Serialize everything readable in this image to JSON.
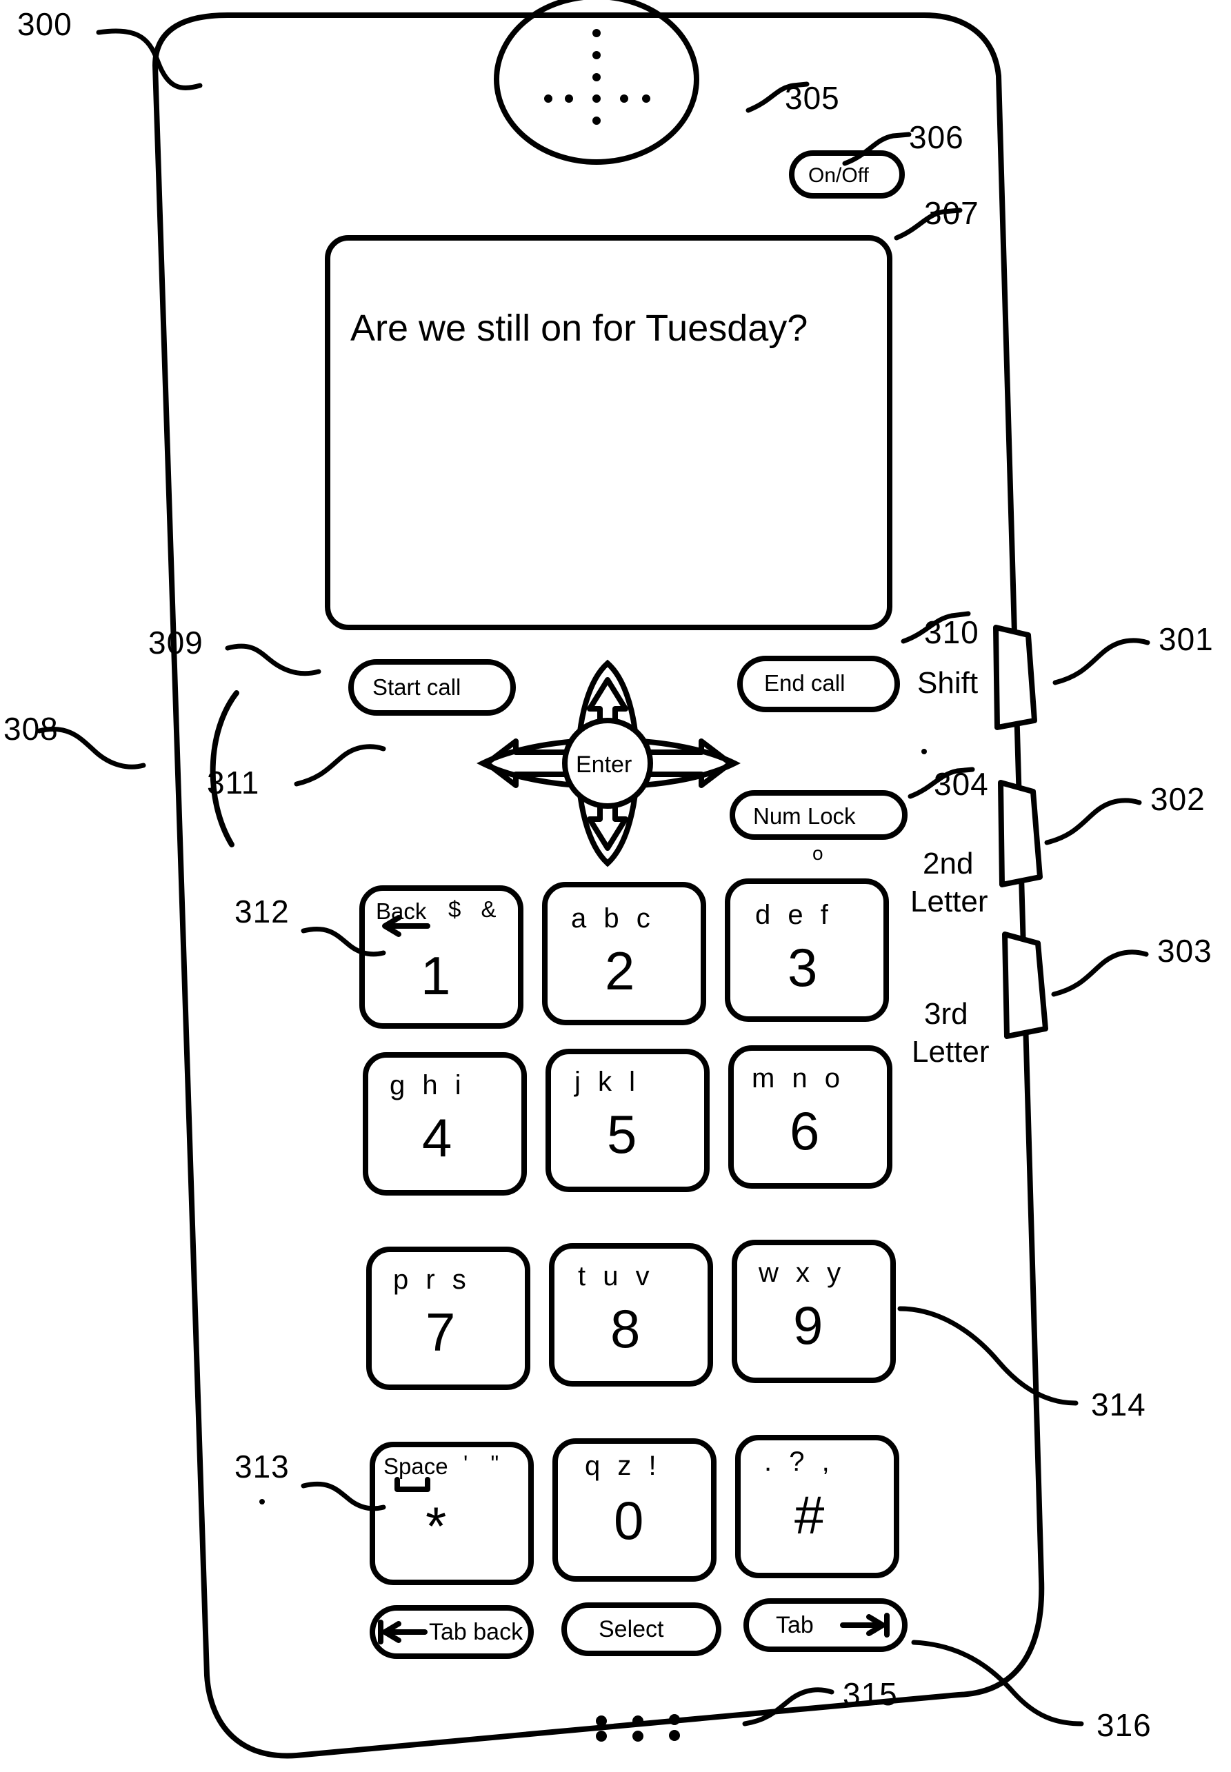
{
  "figure": {
    "kind": "patent-figure",
    "device_name": "handheld telephone with alphanumeric keypad",
    "ink_color": "#000000",
    "background_color": "#ffffff"
  },
  "reference_numerals": [
    {
      "id": "300",
      "label": "300",
      "target": "phone-body"
    },
    {
      "id": "301",
      "label": "301",
      "target": "shift-side-button"
    },
    {
      "id": "302",
      "label": "302",
      "target": "second-letter-side-button"
    },
    {
      "id": "303",
      "label": "303",
      "target": "third-letter-side-button"
    },
    {
      "id": "304",
      "label": "304",
      "target": "num-lock-button"
    },
    {
      "id": "305",
      "label": "305",
      "target": "earpiece-speaker"
    },
    {
      "id": "306",
      "label": "306",
      "target": "on-off-button"
    },
    {
      "id": "307",
      "label": "307",
      "target": "display-screen"
    },
    {
      "id": "308",
      "label": "308",
      "target": "left-edge-bulge"
    },
    {
      "id": "309",
      "label": "309",
      "target": "start-call-button"
    },
    {
      "id": "310",
      "label": "310",
      "target": "end-call-button"
    },
    {
      "id": "311",
      "label": "311",
      "target": "navigation-cluster"
    },
    {
      "id": "312",
      "label": "312",
      "target": "key-1"
    },
    {
      "id": "313",
      "label": "313",
      "target": "key-star"
    },
    {
      "id": "314",
      "label": "314",
      "target": "key-9"
    },
    {
      "id": "315",
      "label": "315",
      "target": "microphone"
    },
    {
      "id": "316",
      "label": "316",
      "target": "tab-button"
    }
  ],
  "display": {
    "message": "Are we still on for Tuesday?"
  },
  "top_controls": {
    "on_off_label": "On/Off"
  },
  "call_controls": {
    "start_call_label": "Start call",
    "end_call_label": "End call",
    "num_lock_label": "Num Lock",
    "num_lock_indicator": "o"
  },
  "navigation": {
    "enter_label": "Enter",
    "up_icon": "arrow-up-icon",
    "down_icon": "arrow-down-icon",
    "left_icon": "arrow-left-icon",
    "right_icon": "arrow-right-icon"
  },
  "side_buttons": [
    {
      "name": "shift",
      "label_line1": "Shift",
      "label_line2": ""
    },
    {
      "name": "second-letter",
      "label_line1": "2nd",
      "label_line2": "Letter"
    },
    {
      "name": "third-letter",
      "label_line1": "3rd",
      "label_line2": "Letter"
    }
  ],
  "keypad": {
    "rows": [
      [
        {
          "name": "key-1",
          "digit": "1",
          "function_label": "Back",
          "function_icon": "arrow-left-icon",
          "symbols": "$ &",
          "letters": ""
        },
        {
          "name": "key-2",
          "digit": "2",
          "letters": "a b c",
          "symbols": ""
        },
        {
          "name": "key-3",
          "digit": "3",
          "letters": "d e f",
          "symbols": ""
        }
      ],
      [
        {
          "name": "key-4",
          "digit": "4",
          "letters": "g h i",
          "symbols": ""
        },
        {
          "name": "key-5",
          "digit": "5",
          "letters": "j k l",
          "symbols": ""
        },
        {
          "name": "key-6",
          "digit": "6",
          "letters": "m n o",
          "symbols": ""
        }
      ],
      [
        {
          "name": "key-7",
          "digit": "7",
          "letters": "p r s",
          "symbols": ""
        },
        {
          "name": "key-8",
          "digit": "8",
          "letters": "t u v",
          "symbols": ""
        },
        {
          "name": "key-9",
          "digit": "9",
          "letters": "w x y",
          "symbols": ""
        }
      ],
      [
        {
          "name": "key-star",
          "digit": "*",
          "function_label": "Space",
          "function_icon": "underscore-bracket-icon",
          "symbols": "'  \"",
          "letters": ""
        },
        {
          "name": "key-0",
          "digit": "0",
          "letters": "q z !",
          "symbols": ""
        },
        {
          "name": "key-hash",
          "digit": "#",
          "letters": ". ? ,",
          "symbols": ""
        }
      ]
    ]
  },
  "bottom_buttons": [
    {
      "name": "tab-back",
      "label": "Tab back",
      "icon": "tab-back-icon",
      "icon_side": "left"
    },
    {
      "name": "select",
      "label": "Select",
      "icon": "",
      "icon_side": ""
    },
    {
      "name": "tab",
      "label": "Tab",
      "icon": "tab-forward-icon",
      "icon_side": "right"
    }
  ],
  "microphone": {
    "pattern": "six-dot-grid",
    "columns": 3,
    "rows": 2
  }
}
